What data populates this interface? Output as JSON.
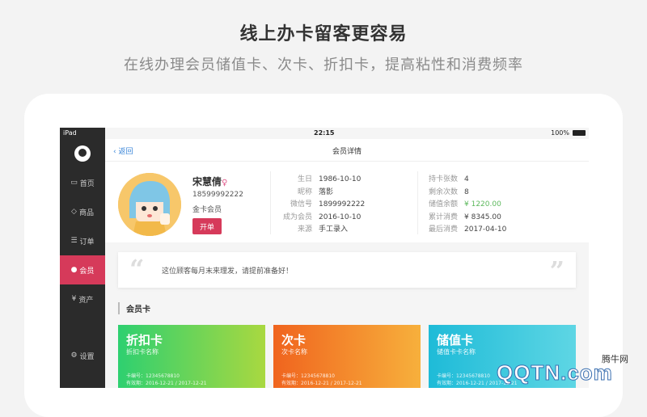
{
  "promo": {
    "title": "线上办卡留客更容易",
    "subtitle": "在线办理会员储值卡、次卡、折扣卡，提高粘性和消费频率"
  },
  "status_bar": {
    "device": "iPad",
    "time": "22:15",
    "battery": "100%"
  },
  "sidebar": {
    "items": [
      {
        "label": "首页",
        "icon": "message-icon"
      },
      {
        "label": "商品",
        "icon": "tag-icon"
      },
      {
        "label": "订单",
        "icon": "list-icon"
      },
      {
        "label": "会员",
        "icon": "user-icon",
        "active": true
      },
      {
        "label": "资产",
        "icon": "yen-icon"
      },
      {
        "label": "设置",
        "icon": "gear-icon"
      }
    ]
  },
  "topbar": {
    "back_label": "返回",
    "title": "会员详情"
  },
  "member": {
    "name": "宋慧倩",
    "gender_icon": "♀",
    "phone": "18599992222",
    "level": "金卡会员",
    "open_card_label": "开单",
    "details": [
      {
        "label": "生日",
        "value": "1986-10-10"
      },
      {
        "label": "昵称",
        "value": "落影"
      },
      {
        "label": "微信号",
        "value": "1899992222"
      },
      {
        "label": "成为会员",
        "value": "2016-10-10"
      },
      {
        "label": "来源",
        "value": "手工录入"
      }
    ],
    "stats": [
      {
        "label": "持卡张数",
        "value": "4"
      },
      {
        "label": "剩余次数",
        "value": "8"
      },
      {
        "label": "储值余额",
        "value": "¥ 1220.00",
        "highlight": "#5cb85c"
      },
      {
        "label": "累计消费",
        "value": "¥ 8345.00"
      },
      {
        "label": "最后消费",
        "value": "2017-04-10"
      }
    ]
  },
  "note": {
    "text": "这位顾客每月末来理发，请提前准备好！"
  },
  "cards_section": {
    "title": "会员卡",
    "cards": [
      {
        "title": "折扣卡",
        "subtitle": "折扣卡名称",
        "number": "卡编号：12345678810",
        "expiry": "有效期：2016-12-21 / 2017-12-21"
      },
      {
        "title": "次卡",
        "subtitle": "次卡名称",
        "number": "卡编号：12345678810",
        "expiry": "有效期：2016-12-21 / 2017-12-21"
      },
      {
        "title": "储值卡",
        "subtitle": "储值卡卡名称",
        "number": "卡编号：12345678810",
        "expiry": "有效期：2016-12-21 / 2017-12-21"
      }
    ]
  },
  "watermark": {
    "brand": "腾牛网",
    "logo": "QQTN.com"
  }
}
